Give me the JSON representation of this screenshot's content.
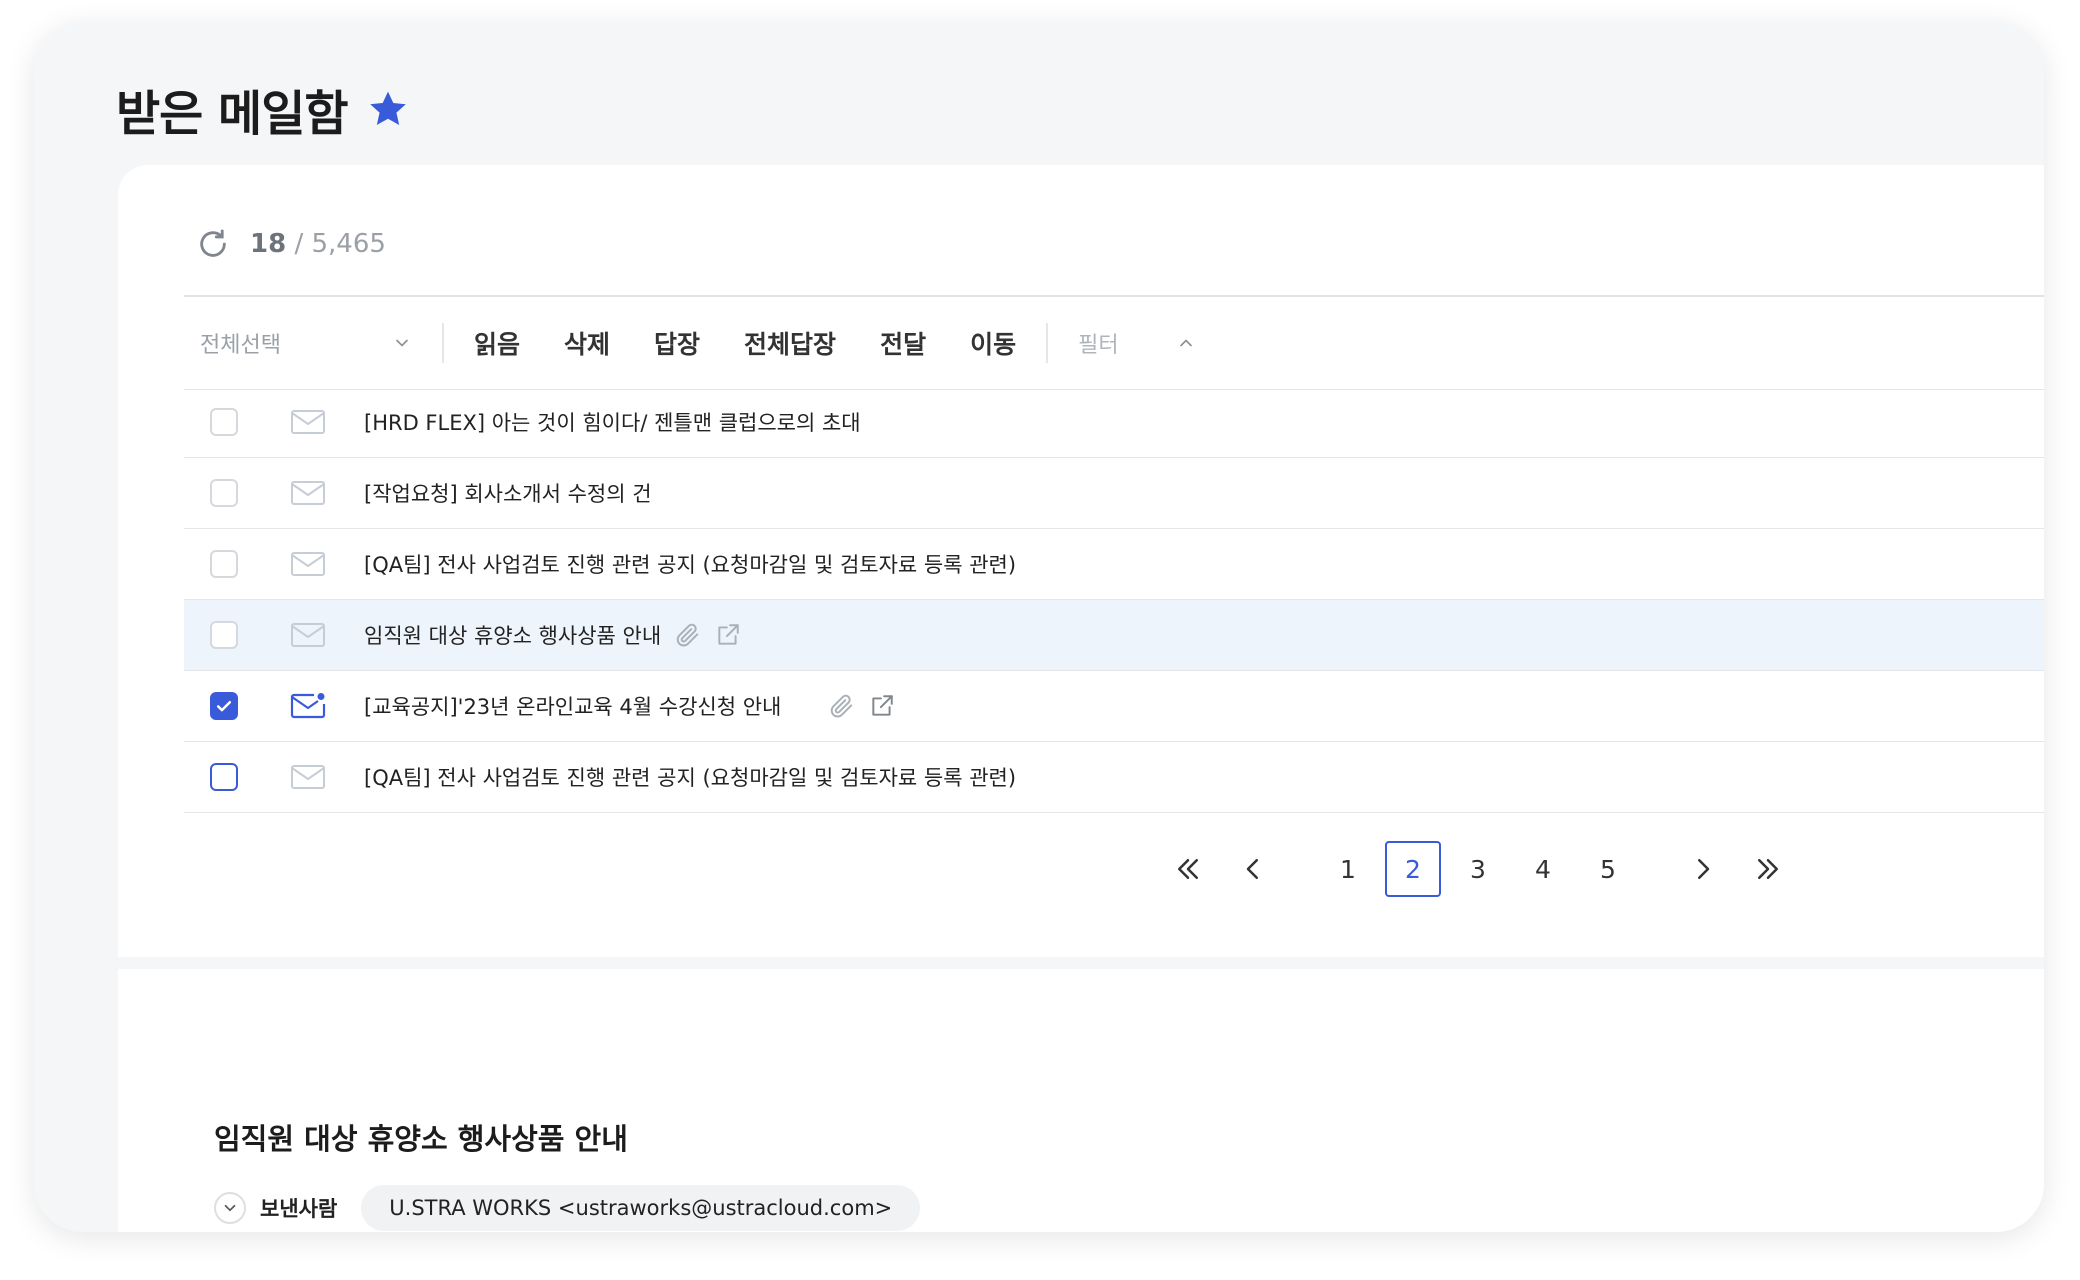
{
  "page": {
    "title": "받은 메일함"
  },
  "counter": {
    "current": "18",
    "total": "/ 5,465"
  },
  "toolbar": {
    "select_all": "전체선택",
    "read": "읽음",
    "delete": "삭제",
    "reply": "답장",
    "reply_all": "전체답장",
    "forward": "전달",
    "move": "이동",
    "filter": "필터"
  },
  "emails": [
    {
      "subject": "[HRD FLEX] 아는 것이 힘이다/ 젠틀맨 클럽으로의 초대",
      "checked": false,
      "highlighted": false,
      "unread": false,
      "attachment": false
    },
    {
      "subject": "[작업요청] 회사소개서 수정의 건",
      "checked": false,
      "highlighted": false,
      "unread": false,
      "attachment": false
    },
    {
      "subject": "[QA팀] 전사 사업검토 진행 관련 공지 (요청마감일 및 검토자료 등록 관련)",
      "checked": false,
      "highlighted": false,
      "unread": false,
      "attachment": false
    },
    {
      "subject": "임직원 대상 휴양소 행사상품 안내",
      "checked": false,
      "highlighted": true,
      "unread": false,
      "attachment": true
    },
    {
      "subject": "[교육공지]'23년 온라인교육 4월 수강신청 안내",
      "checked": true,
      "highlighted": false,
      "unread": true,
      "attachment": true
    },
    {
      "subject": "[QA팀] 전사 사업검토 진행 관련 공지 (요청마감일 및 검토자료 등록 관련)",
      "checked": false,
      "highlighted": false,
      "unread": false,
      "attachment": false
    }
  ],
  "pagination": {
    "pages": [
      "1",
      "2",
      "3",
      "4",
      "5"
    ],
    "current": "2"
  },
  "detail": {
    "title": "임직원 대상 휴양소 행사상품 안내",
    "sender_label": "보낸사람",
    "sender": "U.STRA WORKS <ustraworks@ustracloud.com>"
  },
  "colors": {
    "accent": "#3a5bd9",
    "highlight_row": "#eef4fc",
    "background": "#f5f6f8"
  }
}
